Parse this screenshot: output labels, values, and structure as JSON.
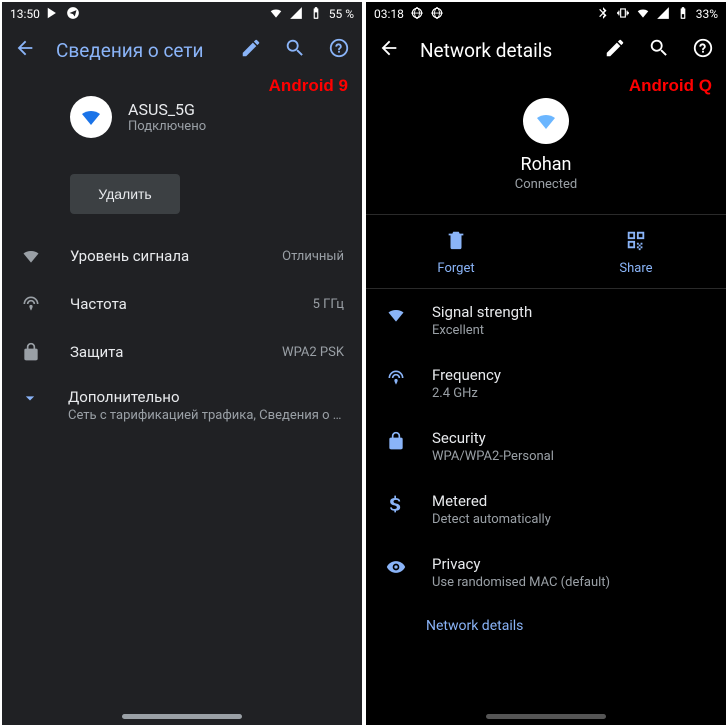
{
  "left": {
    "status": {
      "time": "13:50",
      "battery": "55 %"
    },
    "appbar": {
      "title": "Сведения о сети"
    },
    "version_tag": "Android 9",
    "network": {
      "name": "ASUS_5G",
      "status": "Подключено"
    },
    "forget_label": "Удалить",
    "rows": {
      "signal": {
        "label": "Уровень сигнала",
        "value": "Отличный"
      },
      "freq": {
        "label": "Частота",
        "value": "5 ГГц"
      },
      "sec": {
        "label": "Защита",
        "value": "WPA2 PSK"
      }
    },
    "advanced": {
      "title": "Дополнительно",
      "sub": "Сеть с тарификацией трафика, Сведения о с…"
    }
  },
  "right": {
    "status": {
      "time": "03:18",
      "battery": "33%"
    },
    "appbar": {
      "title": "Network details"
    },
    "version_tag": "Android Q",
    "network": {
      "name": "Rohan",
      "status": "Connected"
    },
    "actions": {
      "forget": "Forget",
      "share": "Share"
    },
    "rows": {
      "signal": {
        "label": "Signal strength",
        "value": "Excellent"
      },
      "freq": {
        "label": "Frequency",
        "value": "2.4 GHz"
      },
      "sec": {
        "label": "Security",
        "value": "WPA/WPA2-Personal"
      },
      "metered": {
        "label": "Metered",
        "value": "Detect automatically"
      },
      "privacy": {
        "label": "Privacy",
        "value": "Use randomised MAC (default)"
      }
    },
    "section_label": "Network details"
  }
}
